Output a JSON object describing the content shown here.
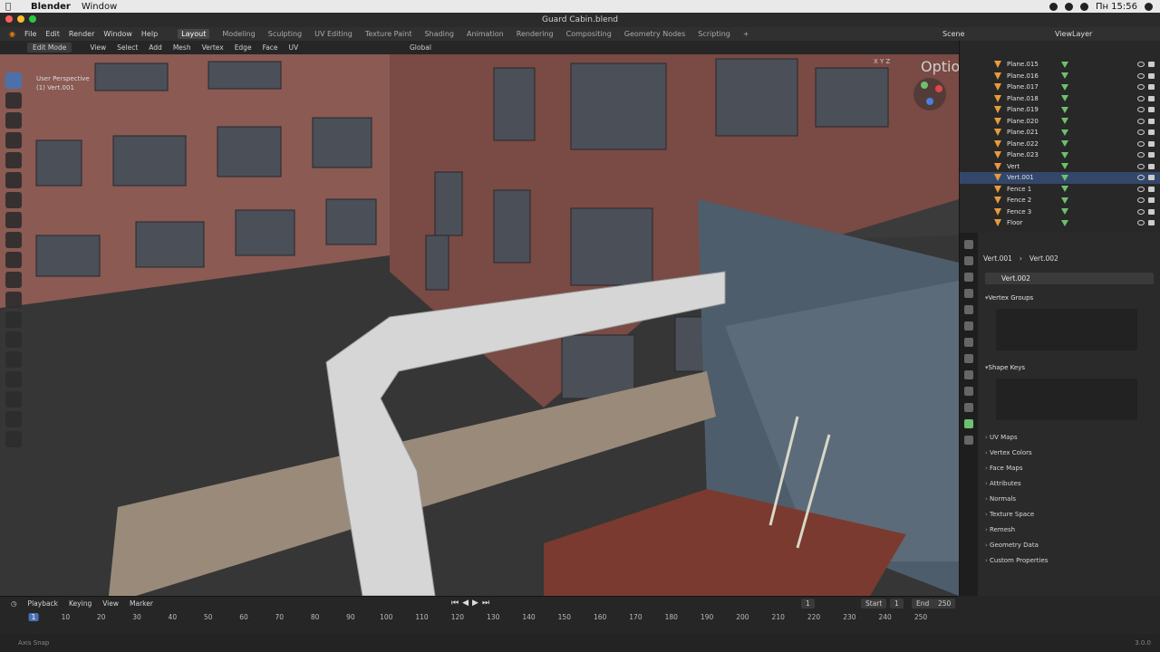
{
  "mac": {
    "app": "Blender",
    "menus": [
      "Window"
    ],
    "clock": "Пн 15:56"
  },
  "window": {
    "title": "Guard Cabin.blend"
  },
  "topbar": {
    "menus": [
      "File",
      "Edit",
      "Render",
      "Window",
      "Help"
    ],
    "workspaces": [
      "Layout",
      "Modeling",
      "Sculpting",
      "UV Editing",
      "Texture Paint",
      "Shading",
      "Animation",
      "Rendering",
      "Compositing",
      "Geometry Nodes",
      "Scripting"
    ],
    "active_workspace": "Layout",
    "scene": "Scene",
    "view_layer": "ViewLayer"
  },
  "viewport_header": {
    "mode": "Edit Mode",
    "menus": [
      "View",
      "Select",
      "Add",
      "Mesh",
      "Vertex",
      "Edge",
      "Face",
      "UV"
    ],
    "transform": "Global",
    "axes": "X Y Z",
    "options": "Options"
  },
  "viewport": {
    "view": "User Perspective",
    "object": "(1) Vert.001"
  },
  "outliner": {
    "items": [
      {
        "name": "Plane.015",
        "selected": false
      },
      {
        "name": "Plane.016",
        "selected": false
      },
      {
        "name": "Plane.017",
        "selected": false
      },
      {
        "name": "Plane.018",
        "selected": false
      },
      {
        "name": "Plane.019",
        "selected": false
      },
      {
        "name": "Plane.020",
        "selected": false
      },
      {
        "name": "Plane.021",
        "selected": false
      },
      {
        "name": "Plane.022",
        "selected": false
      },
      {
        "name": "Plane.023",
        "selected": false
      },
      {
        "name": "Vert",
        "selected": false
      },
      {
        "name": "Vert.001",
        "selected": true
      },
      {
        "name": "Fence 1",
        "selected": false
      },
      {
        "name": "Fence 2",
        "selected": false
      },
      {
        "name": "Fence 3",
        "selected": false
      },
      {
        "name": "Floor",
        "selected": false
      }
    ]
  },
  "properties": {
    "breadcrumb_object": "Vert.001",
    "breadcrumb_mesh": "Vert.002",
    "mesh_name": "Vert.002",
    "open_panels": [
      "Vertex Groups",
      "Shape Keys"
    ],
    "closed_panels": [
      "UV Maps",
      "Vertex Colors",
      "Face Maps",
      "Attributes",
      "Normals",
      "Texture Space",
      "Remesh",
      "Geometry Data",
      "Custom Properties"
    ]
  },
  "timeline": {
    "menus": [
      "Playback",
      "Keying",
      "View",
      "Marker"
    ],
    "current_frame": "1",
    "start_label": "Start",
    "start": "1",
    "end_label": "End",
    "end": "250",
    "ruler": [
      "1",
      "10",
      "20",
      "30",
      "40",
      "50",
      "60",
      "70",
      "80",
      "90",
      "100",
      "110",
      "120",
      "130",
      "140",
      "150",
      "160",
      "170",
      "180",
      "190",
      "200",
      "210",
      "220",
      "230",
      "240",
      "250"
    ]
  },
  "status": {
    "left": "Axis Snap",
    "version": "3.0.0"
  },
  "colors": {
    "accent": "#4772b3",
    "object": "#e89a3c",
    "mesh": "#6ec06e"
  }
}
